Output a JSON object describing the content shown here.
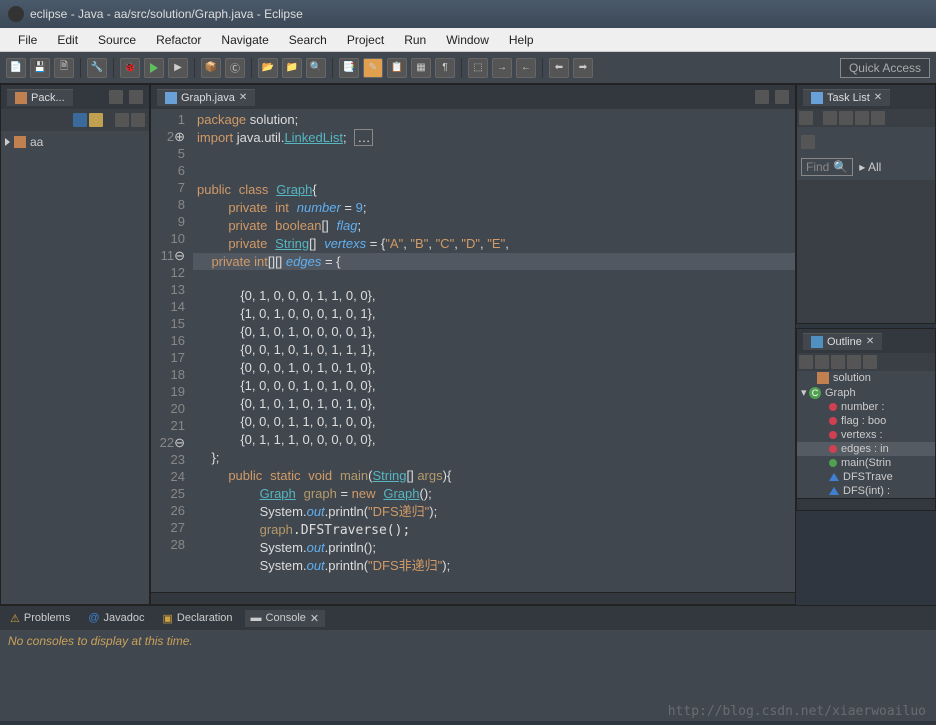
{
  "title": "eclipse - Java - aa/src/solution/Graph.java - Eclipse",
  "menu": [
    "File",
    "Edit",
    "Source",
    "Refactor",
    "Navigate",
    "Search",
    "Project",
    "Run",
    "Window",
    "Help"
  ],
  "quick_access": "Quick Access",
  "left_panel": {
    "title": "Pack...",
    "project": "aa"
  },
  "editor": {
    "tab": "Graph.java",
    "lines": [
      1,
      2,
      5,
      6,
      7,
      8,
      9,
      10,
      11,
      12,
      13,
      14,
      15,
      16,
      17,
      18,
      19,
      20,
      21,
      22,
      23,
      24,
      25,
      26,
      27,
      28
    ]
  },
  "code": {
    "l1a": "package",
    "l1b": " solution;",
    "l2a": "import",
    "l2b": " java.util.",
    "l2c": "LinkedList",
    "l2d": ";",
    "l7a": "public",
    "l7b": "class",
    "l7c": "Graph",
    "l7d": "{",
    "l8a": "private",
    "l8b": "int",
    "l8c": "number",
    "l8d": " = ",
    "l8e": "9",
    "l8f": ";",
    "l9a": "private",
    "l9b": "boolean",
    "l9c": "[]",
    "l9d": "flag",
    "l9e": ";",
    "l10a": "private",
    "l10b": "String",
    "l10c": "[]",
    "l10d": "vertexs",
    "l10e": " = {",
    "l10f": "\"A\"",
    "l10g": ", ",
    "l10h": "\"B\"",
    "l10i": ", ",
    "l10j": "\"C\"",
    "l10k": ", ",
    "l10l": "\"D\"",
    "l10m": ", ",
    "l10n": "\"E\"",
    "l10o": ",",
    "l11a": "private",
    "l11b": "int",
    "l11c": "[][]",
    "l11d": "edges",
    "l11e": " = {",
    "l12": "            {0, 1, 0, 0, 0, 1, 1, 0, 0},",
    "l13": "            {1, 0, 1, 0, 0, 0, 1, 0, 1},",
    "l14": "            {0, 1, 0, 1, 0, 0, 0, 0, 1},",
    "l15": "            {0, 0, 1, 0, 1, 0, 1, 1, 1},",
    "l16": "            {0, 0, 0, 1, 0, 1, 0, 1, 0},",
    "l17": "            {1, 0, 0, 0, 1, 0, 1, 0, 0},",
    "l18": "            {0, 1, 0, 1, 0, 1, 0, 1, 0},",
    "l19": "            {0, 0, 0, 1, 1, 0, 1, 0, 0},",
    "l20": "            {0, 1, 1, 1, 0, 0, 0, 0, 0},",
    "l21": "    };",
    "l22a": "public",
    "l22b": "static",
    "l22c": "void",
    "l22d": "main",
    "l22e": "(",
    "l22f": "String",
    "l22g": "[] ",
    "l22h": "args",
    "l22i": "){",
    "l23a": "Graph",
    "l23b": "graph",
    "l23c": " = ",
    "l23d": "new",
    "l23e": "Graph",
    "l23f": "();",
    "l24a": "System.",
    "l24b": "out",
    "l24c": ".println(",
    "l24d": "\"DFS递归\"",
    "l24e": ");",
    "l25a": "graph",
    ".l25b": ".DFSTraverse();",
    "l26a": "System.",
    "l26b": "out",
    "l26c": ".println();",
    "l27a": "System.",
    "l27b": "out",
    "l27c": ".println(",
    "l27d": "\"DFS非递归\"",
    "l27e": ");"
  },
  "task": {
    "title": "Task List",
    "find": "Find",
    "all": "All"
  },
  "outline": {
    "title": "Outline",
    "pkg": "solution",
    "cls": "Graph",
    "m1": "number :",
    "m2": "flag : boo",
    "m3": "vertexs :",
    "m4": "edges : in",
    "m5": "main(Strin",
    "m6": "DFSTrave",
    "m7": "DFS(int) :"
  },
  "bottom": {
    "tabs": [
      "Problems",
      "Javadoc",
      "Declaration",
      "Console"
    ],
    "msg": "No consoles to display at this time."
  },
  "watermark": "http://blog.csdn.net/xiaerwoailuo"
}
